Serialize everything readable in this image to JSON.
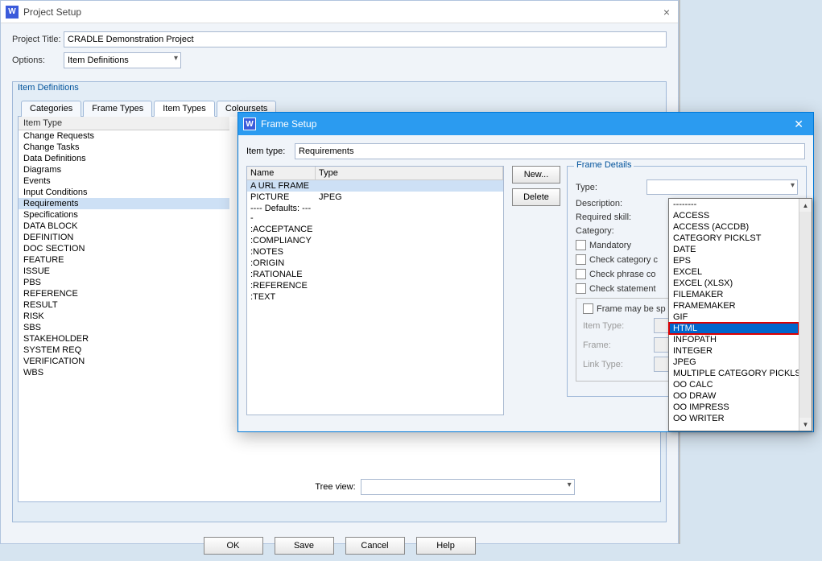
{
  "mainWindow": {
    "title": "Project Setup",
    "projectTitleLabel": "Project Title:",
    "projectTitle": "CRADLE Demonstration Project",
    "optionsLabel": "Options:",
    "optionsValue": "Item Definitions",
    "groupTitle": "Item Definitions",
    "tabs": [
      "Categories",
      "Frame Types",
      "Item Types",
      "Coloursets"
    ],
    "activeTab": "Item Types",
    "listHeader": "Item Type",
    "items": [
      "Change Requests",
      "Change Tasks",
      "Data Definitions",
      "Diagrams",
      "Events",
      "Input Conditions",
      "Requirements",
      "Specifications",
      "DATA BLOCK",
      "DEFINITION",
      "DOC SECTION",
      "FEATURE",
      "ISSUE",
      "PBS",
      "REFERENCE",
      "RESULT",
      "RISK",
      "SBS",
      "STAKEHOLDER",
      "SYSTEM REQ",
      "VERIFICATION",
      "WBS"
    ],
    "selected": "Requirements",
    "treeViewLabel": "Tree view:",
    "buttons": {
      "ok": "OK",
      "save": "Save",
      "cancel": "Cancel",
      "help": "Help"
    }
  },
  "frameDialog": {
    "title": "Frame Setup",
    "itemTypeLabel": "Item type:",
    "itemTypeValue": "Requirements",
    "cols": {
      "name": "Name",
      "type": "Type"
    },
    "rows": [
      {
        "name": "A URL FRAME",
        "type": ""
      },
      {
        "name": "PICTURE",
        "type": "JPEG"
      },
      {
        "name": "---- Defaults: ----",
        "type": ""
      },
      {
        "name": ":ACCEPTANCE",
        "type": ""
      },
      {
        "name": ":COMPLIANCY",
        "type": ""
      },
      {
        "name": ":NOTES",
        "type": ""
      },
      {
        "name": ":ORIGIN",
        "type": ""
      },
      {
        "name": ":RATIONALE",
        "type": ""
      },
      {
        "name": ":REFERENCE",
        "type": ""
      },
      {
        "name": ":TEXT",
        "type": ""
      }
    ],
    "selectedRow": 0,
    "sideButtons": {
      "new": "New...",
      "delete": "Delete"
    },
    "detailsTitle": "Frame Details",
    "details": {
      "typeLabel": "Type:",
      "descLabel": "Description:",
      "skillLabel": "Required skill:",
      "catLabel": "Category:",
      "mandatory": "Mandatory",
      "checkCat": "Check category c",
      "checkPhrase": "Check phrase co",
      "checkStmt": "Check statement",
      "frameMaybe": "Frame may be sp",
      "itemTypeLbl": "Item Type:",
      "frameLbl": "Frame:",
      "linkTypeLbl": "Link Type:"
    }
  },
  "dropdown": {
    "items": [
      "--------",
      "ACCESS",
      "ACCESS (ACCDB)",
      "CATEGORY PICKLST",
      "DATE",
      "EPS",
      "EXCEL",
      "EXCEL (XLSX)",
      "FILEMAKER",
      "FRAMEMAKER",
      "GIF",
      "HTML",
      "INFOPATH",
      "INTEGER",
      "JPEG",
      "MULTIPLE CATEGORY PICKLST",
      "OO CALC",
      "OO DRAW",
      "OO IMPRESS",
      "OO WRITER"
    ],
    "highlighted": "HTML"
  }
}
